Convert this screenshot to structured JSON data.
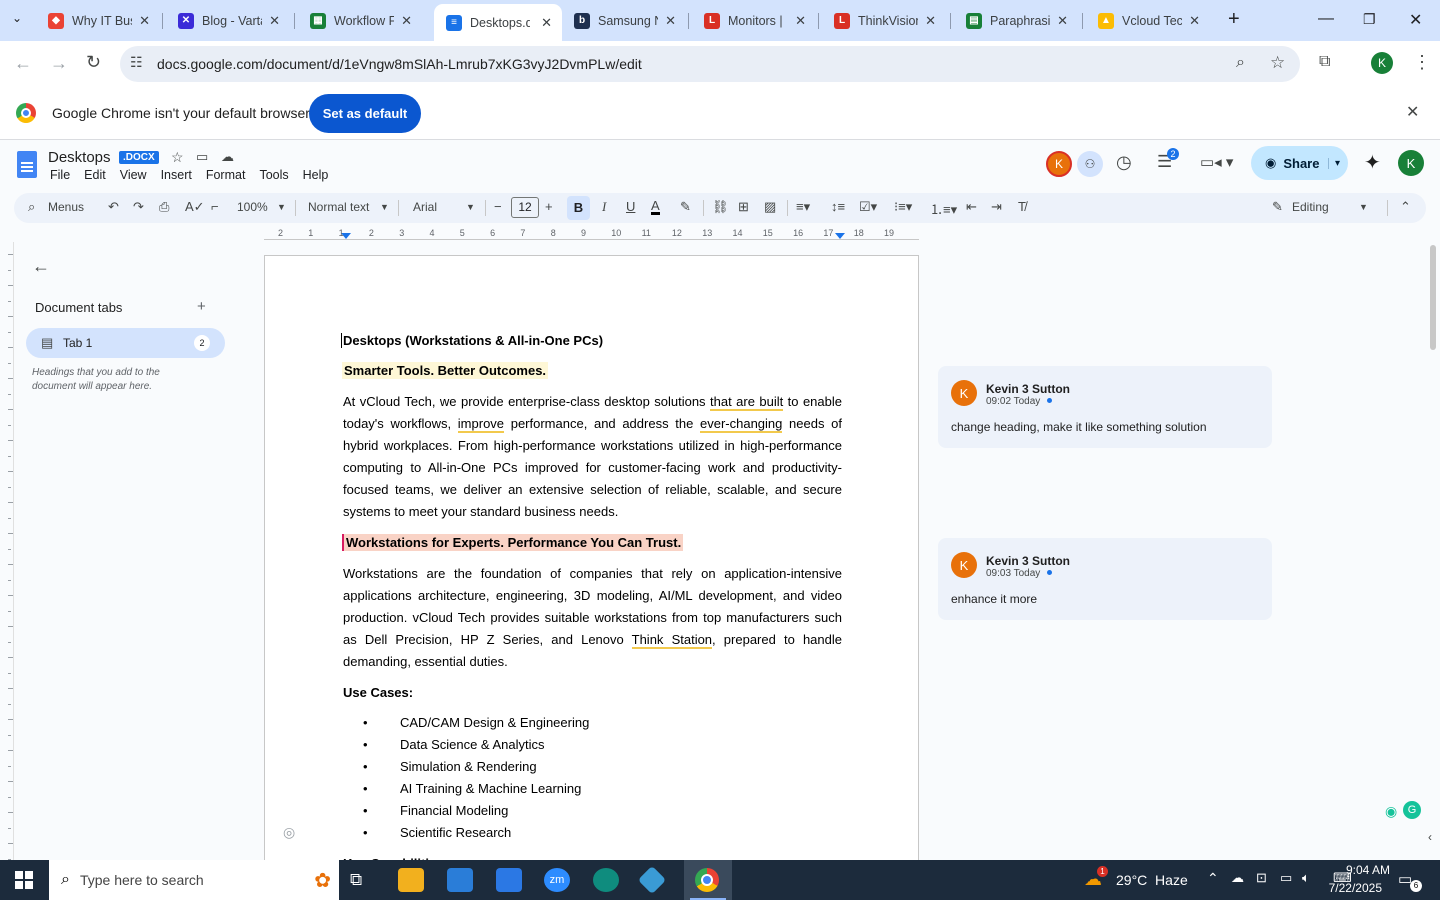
{
  "browser": {
    "tabs": [
      {
        "title": "Why IT Bus",
        "color": "#ea4335",
        "glyph": "◆"
      },
      {
        "title": "Blog - Varta",
        "color": "#3b2bd8",
        "glyph": "✕"
      },
      {
        "title": "Workflow F",
        "color": "#188038",
        "glyph": "▦"
      },
      {
        "title": "Desktops.d",
        "color": "#1a73e8",
        "glyph": "≡"
      },
      {
        "title": "Samsung N",
        "color": "#1e3050",
        "glyph": "b"
      },
      {
        "title": "Monitors |",
        "color": "#d93025",
        "glyph": "L"
      },
      {
        "title": "ThinkVision",
        "color": "#d93025",
        "glyph": "L"
      },
      {
        "title": "Paraphrasin",
        "color": "#188038",
        "glyph": "▤"
      },
      {
        "title": "Vcloud Tec",
        "color": "#fbbc04",
        "glyph": "▲"
      }
    ],
    "url": "docs.google.com/document/d/1eVngw8mSlAh-Lmrub7xKG3vyJ2DvmPLw/edit",
    "profile_initial": "K"
  },
  "infobar": {
    "message": "Google Chrome isn't your default browser",
    "button": "Set as default"
  },
  "doc": {
    "title": "Desktops",
    "badge": ".DOCX",
    "menus": [
      "File",
      "Edit",
      "View",
      "Insert",
      "Format",
      "Tools",
      "Help"
    ],
    "share": "Share",
    "comment_count": "2",
    "user_initial": "K"
  },
  "format": {
    "menus": "Menus",
    "zoom": "100%",
    "style": "Normal text",
    "font": "Arial",
    "size": "12",
    "mode": "Editing"
  },
  "ruler": [
    "2",
    "1",
    "1",
    "2",
    "3",
    "4",
    "5",
    "6",
    "7",
    "8",
    "9",
    "10",
    "11",
    "12",
    "13",
    "14",
    "15",
    "16",
    "17",
    "18",
    "19"
  ],
  "sidebar": {
    "heading": "Document tabs",
    "tab_label": "Tab 1",
    "tab_count": "2",
    "hint": "Headings that you add to the document will appear here."
  },
  "content": {
    "h1": "Desktops (Workstations & All-in-One PCs)",
    "h2": "Smarter Tools. Better Outcomes.",
    "p1_a": "At vCloud Tech, we provide enterprise-class desktop solutions ",
    "p1_u1": "that are built",
    "p1_b": " to enable today's workflows, ",
    "p1_u2": "improve",
    "p1_c": " performance, and address the ",
    "p1_u3": "ever-changing",
    "p1_d": " needs of hybrid workplaces. From high-performance workstations utilized in high-performance computing to All-in-One PCs improved for customer-facing work and productivity-focused teams, we deliver an extensive selection of reliable, scalable, and secure systems to meet your standard business needs.",
    "h3": "Workstations for Experts. Performance You Can Trust.",
    "p2_a": "Workstations are the foundation of companies that rely on application-intensive applications architecture, engineering, 3D modeling, AI/ML development, and video production. vCloud Tech provides suitable workstations from top manufacturers such as Dell Precision, HP Z Series, and Lenovo ",
    "p2_u": "Think Station",
    "p2_b": ", prepared to handle demanding, essential duties.",
    "h4": "Use Cases:",
    "bullets": [
      "CAD/CAM Design & Engineering",
      "Data Science & Analytics",
      "Simulation & Rendering",
      "AI Training & Machine Learning",
      "Financial Modeling",
      "Scientific Research"
    ],
    "partial": "Key Capabilities"
  },
  "comments": [
    {
      "initial": "K",
      "author": "Kevin 3 Sutton",
      "time": "09:02 Today",
      "text": "change heading, make it like something solution"
    },
    {
      "initial": "K",
      "author": "Kevin 3 Sutton",
      "time": "09:03 Today",
      "text": "enhance it more"
    }
  ],
  "taskbar": {
    "search_placeholder": "Type here to search",
    "weather": "29°C  Haze",
    "time": "9:04 AM",
    "date": "7/22/2025",
    "notif": "6",
    "weather_badge": "1"
  }
}
